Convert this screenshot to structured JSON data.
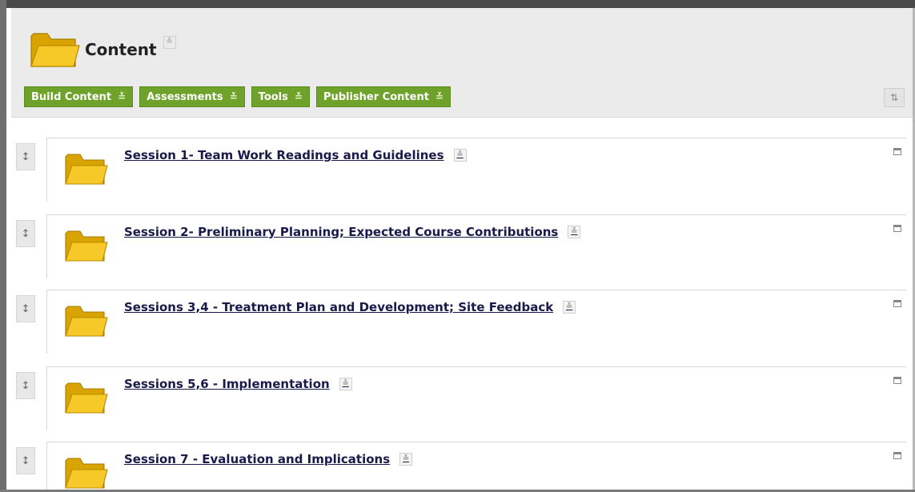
{
  "header": {
    "title": "Content",
    "title_menu_icon": "double-chevron-down-icon",
    "folder_icon": "folder-icon"
  },
  "toolbar": {
    "buttons": [
      {
        "label": "Build Content",
        "icon": "double-chevron-down-icon"
      },
      {
        "label": "Assessments",
        "icon": "double-chevron-down-icon"
      },
      {
        "label": "Tools",
        "icon": "double-chevron-down-icon"
      },
      {
        "label": "Publisher Content",
        "icon": "double-chevron-down-icon"
      }
    ],
    "sort_icon": "reorder-arrows-icon"
  },
  "items": [
    {
      "title": "Session 1- Team Work Readings and Guidelines"
    },
    {
      "title": "Session 2- Preliminary Planning; Expected Course Contributions"
    },
    {
      "title": "Sessions 3,4 - Treatment Plan and Development; Site Feedback"
    },
    {
      "title": "Sessions 5,6 - Implementation"
    },
    {
      "title": "Session 7 - Evaluation and Implications"
    }
  ],
  "colors": {
    "toolbar_button": "#6fa22a",
    "header_bg": "#ebebeb",
    "folder_yellow": "#f2c11c",
    "link_text": "#1a1a4a"
  }
}
